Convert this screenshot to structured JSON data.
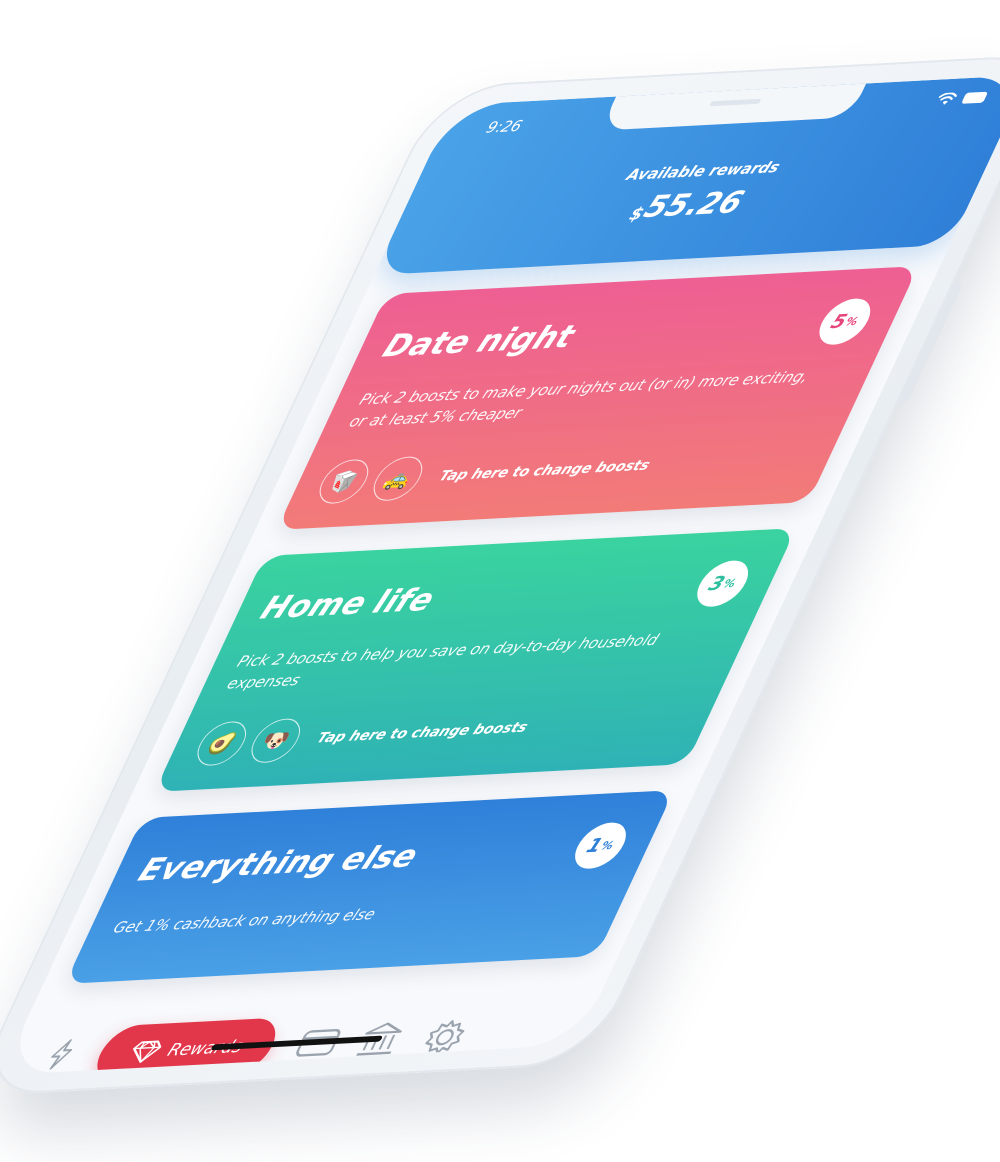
{
  "status": {
    "time": "9:26",
    "wifi_icon": "wifi-icon",
    "battery_icon": "battery-icon"
  },
  "header": {
    "label": "Available rewards",
    "currency": "$",
    "amount": "55.26"
  },
  "cards": [
    {
      "title": "Date night",
      "percent": "5",
      "percent_suffix": "%",
      "description": "Pick 2 boosts to make your nights out (or in) more exciting, or at least 5% cheaper",
      "boost_icons": [
        "takeout-box-icon",
        "taxi-icon"
      ],
      "boost_glyphs": [
        "🥡",
        "🚕"
      ],
      "action_label": "Tap here to change boosts",
      "accent_color": "#e6457a"
    },
    {
      "title": "Home life",
      "percent": "3",
      "percent_suffix": "%",
      "description": "Pick 2 boosts to help you save on day-to-day household expenses",
      "boost_icons": [
        "avocado-icon",
        "dog-icon"
      ],
      "boost_glyphs": [
        "🥑",
        "🐶"
      ],
      "action_label": "Tap here to change boosts",
      "accent_color": "#2fbf9f"
    },
    {
      "title": "Everything else",
      "percent": "1",
      "percent_suffix": "%",
      "description": "Get 1% cashback on anything else",
      "accent_color": "#2f7fd8"
    }
  ],
  "tabbar": {
    "rewards_label": "Rewards",
    "active_color": "#e2374a",
    "icons": [
      "lightning-icon",
      "diamond-icon",
      "card-icon",
      "bank-icon",
      "gear-icon"
    ]
  }
}
